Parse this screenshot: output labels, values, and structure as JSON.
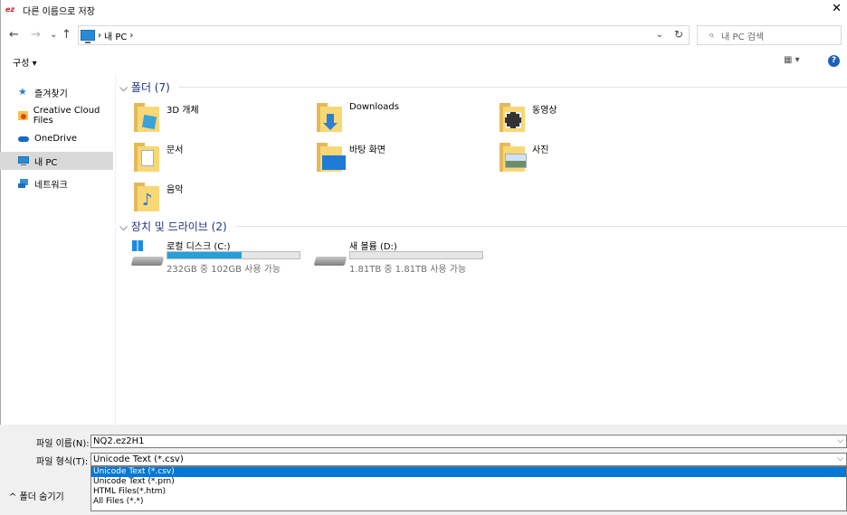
{
  "window": {
    "title": "다른 이름으로 저장",
    "logo_text": "ez",
    "close_glyph": "✕"
  },
  "address": {
    "back_glyph": "←",
    "forward_glyph": "→",
    "recent_glyph": "⌄",
    "up_glyph": "↑",
    "crumb_sep": "›",
    "crumb": "내 PC",
    "crumb_trail": "›",
    "dropdown_glyph": "⌄",
    "refresh_glyph": "↻"
  },
  "search": {
    "placeholder": "내 PC 검색",
    "icon_glyph": "⌕"
  },
  "toolbar": {
    "organize_label": "구성 ▾",
    "view_label": "▦ ▾",
    "help_label": "?"
  },
  "nav": {
    "items": [
      {
        "label": "즐겨찾기",
        "icon": "star-icon"
      },
      {
        "label": "Creative Cloud Files",
        "icon": "creative-cloud-icon"
      },
      {
        "label": "OneDrive",
        "icon": "cloud-icon"
      },
      {
        "label": "내 PC",
        "icon": "computer-icon",
        "selected": true
      },
      {
        "label": "네트워크",
        "icon": "network-icon"
      }
    ]
  },
  "groups": {
    "folders_title": "⌵ 폴더 (7)",
    "drives_title": "⌵ 장치 및 드라이브 (2)"
  },
  "folders": [
    {
      "label": "3D 개체",
      "icon": "3d-objects-folder-icon"
    },
    {
      "label": "Downloads",
      "icon": "downloads-folder-icon"
    },
    {
      "label": "동영상",
      "icon": "videos-folder-icon"
    },
    {
      "label": "문서",
      "icon": "documents-folder-icon"
    },
    {
      "label": "바탕 화면",
      "icon": "desktop-folder-icon"
    },
    {
      "label": "사진",
      "icon": "pictures-folder-icon"
    },
    {
      "label": "음악",
      "icon": "music-folder-icon"
    }
  ],
  "drives": [
    {
      "label": "로컬 디스크 (C:)",
      "usage": "232GB 중 102GB 사용 가능",
      "used_fraction": 0.56,
      "icon": "windows-drive-icon"
    },
    {
      "label": "새 볼륨 (D:)",
      "usage": "1.81TB 중 1.81TB 사용 가능",
      "used_fraction": 0.0,
      "icon": "drive-icon"
    }
  ],
  "form": {
    "filename_label": "파일 이름(N):",
    "filename_value": "NQ2.ez2H1",
    "filetype_label": "파일 형식(T):",
    "filetype_value": "Unicode Text (*.csv)",
    "dropdown_glyph": "⌵",
    "filetype_options": [
      "Unicode Text (*.csv)",
      "Unicode Text (*.prn)",
      "HTML Files(*.htm)",
      "All Files (*.*)"
    ],
    "hide_folders_label": "^ 폴더 숨기기"
  },
  "colors": {
    "accent": "#0078d7",
    "drive_fill": "#26a0da",
    "group_header": "#1e3287",
    "logo": "#e8141c"
  }
}
